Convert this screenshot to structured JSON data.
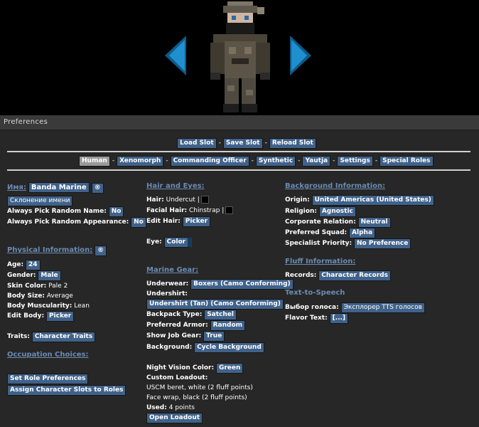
{
  "window": {
    "title": "Preferences"
  },
  "slots": {
    "load": "Load Slot",
    "save": "Save Slot",
    "reload": "Reload Slot"
  },
  "tabs": [
    "Human",
    "Xenomorph",
    "Commanding Officer",
    "Synthetic",
    "Yautja",
    "Settings",
    "Special Roles"
  ],
  "col1": {
    "name_label": "Имя:",
    "name_value": "Banda Marine",
    "random_name_btn": "®",
    "declension_btn": "Склонение имени",
    "always_random_name_label": "Always Pick Random Name:",
    "always_random_name_value": "No",
    "always_random_appearance_label": "Always Pick Random Appearance:",
    "always_random_appearance_value": "No",
    "physical_header": "Physical Information:",
    "physical_random_btn": "®",
    "age_label": "Age:",
    "age_value": "24",
    "gender_label": "Gender:",
    "gender_value": "Male",
    "skin_label": "Skin Color:",
    "skin_value": "Pale 2",
    "body_size_label": "Body Size:",
    "body_size_value": "Average",
    "muscularity_label": "Body Muscularity:",
    "muscularity_value": "Lean",
    "edit_body_label": "Edit Body:",
    "edit_body_value": "Picker",
    "traits_label": "Traits:",
    "traits_value": "Character Traits",
    "occupation_header": "Occupation Choices:",
    "set_role_btn": "Set Role Preferences",
    "assign_slots_btn": "Assign Character Slots to Roles"
  },
  "col2": {
    "hair_header": "Hair and Eyes:",
    "hair_label": "Hair:",
    "hair_value": "Undercut |",
    "facial_hair_label": "Facial Hair:",
    "facial_hair_value": "Chinstrap |",
    "edit_hair_label": "Edit Hair:",
    "edit_hair_value": "Picker",
    "eye_label": "Eye:",
    "eye_value": "Color",
    "gear_header": "Marine Gear:",
    "underwear_label": "Underwear:",
    "underwear_value": "Boxers (Camo Conforming)",
    "undershirt_label": "Undershirt:",
    "undershirt_value": "Undershirt (Tan) (Camo Conforming)",
    "backpack_label": "Backpack Type:",
    "backpack_value": "Satchel",
    "armor_label": "Preferred Armor:",
    "armor_value": "Random",
    "jobgear_label": "Show Job Gear:",
    "jobgear_value": "True",
    "background_label": "Background:",
    "background_value": "Cycle Background",
    "nvg_label": "Night Vision Color:",
    "nvg_value": "Green",
    "loadout_label": "Custom Loadout:",
    "loadout_items": [
      "USCM beret, white (2 fluff points)",
      "Face wrap, black (2 fluff points)"
    ],
    "used_label": "Used:",
    "used_value": "4 points",
    "open_loadout_btn": "Open Loadout"
  },
  "col3": {
    "background_header": "Background Information:",
    "origin_label": "Origin:",
    "origin_value": "United Americas (United States)",
    "religion_label": "Religion:",
    "religion_value": "Agnostic",
    "corp_label": "Corporate Relation:",
    "corp_value": "Neutral",
    "squad_label": "Preferred Squad:",
    "squad_value": "Alpha",
    "specialist_label": "Specialist Priority:",
    "specialist_value": "No Preference",
    "fluff_header": "Fluff Information:",
    "records_label": "Records:",
    "records_value": "Character Records",
    "tts_header": "Text-to-Speech",
    "voice_label": "Выбор голоса:",
    "voice_value": "Эксплорер TTS голосов",
    "flavor_label": "Flavor Text:",
    "flavor_value": "[...]"
  },
  "colors": {
    "button": "#40628a",
    "header": "#6a8bb4",
    "arrow": "#1f8fd0",
    "background": "#272727"
  }
}
